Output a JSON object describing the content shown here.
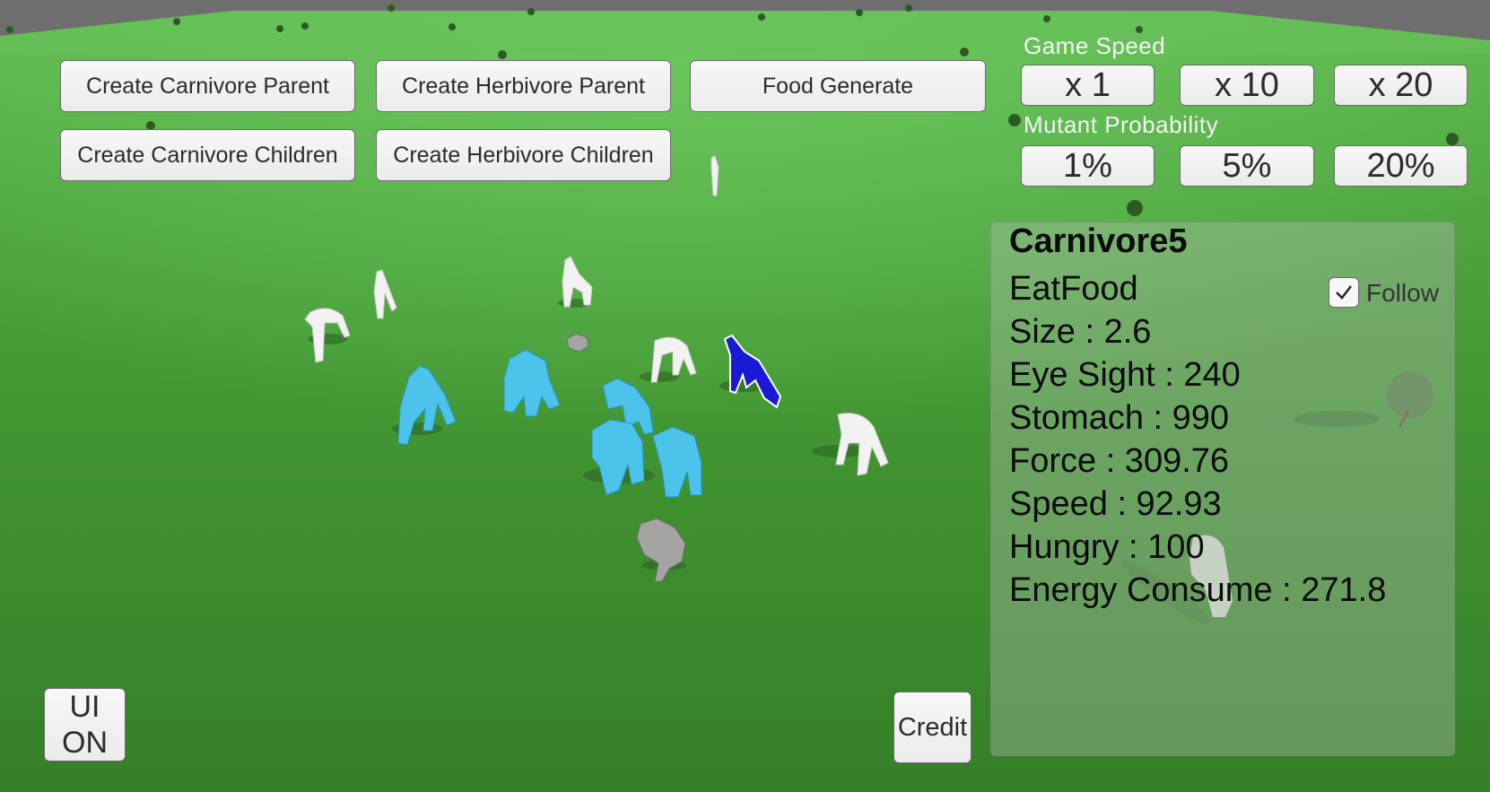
{
  "buttons": {
    "create_carnivore_parent": "Create Carnivore Parent",
    "create_herbivore_parent": "Create Herbivore Parent",
    "food_generate": "Food Generate",
    "create_carnivore_children": "Create Carnivore Children",
    "create_herbivore_children": "Create Herbivore Children",
    "ui_toggle": "UI ON",
    "credit": "Credit"
  },
  "game_speed": {
    "label": "Game Speed",
    "options": [
      "x 1",
      "x 10",
      "x 20"
    ]
  },
  "mutant_probability": {
    "label": "Mutant Probability",
    "options": [
      "1%",
      "5%",
      "20%"
    ]
  },
  "info_panel": {
    "name": "Carnivore5",
    "state": "EatFood",
    "follow_label": "Follow",
    "follow_checked": true,
    "stats": [
      "Size : 2.6",
      "Eye Sight : 240",
      "Stomach : 990",
      "Force : 309.76",
      "Speed : 92.93",
      "Hungry : 100",
      "Energy Consume : 271.8"
    ]
  },
  "colors": {
    "grass": "#3f8f33",
    "carnivore": "#ffffff",
    "herbivore": "#4cc3ea",
    "selected": "#1a1ad6",
    "food": "#9a9a9a"
  }
}
